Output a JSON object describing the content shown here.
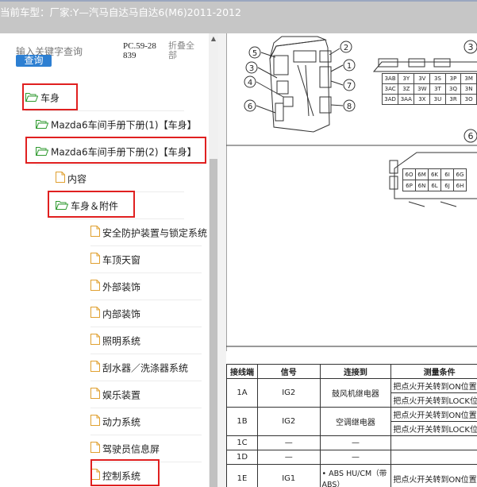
{
  "titlebar": {
    "label": "当前车型：",
    "value": "厂家:Y—汽马自达马自达6(M6)2011-2012"
  },
  "search": {
    "placeholder": "输入关键字查询",
    "button_label": "查询"
  },
  "pc_code": "PC.59-28839",
  "collapse_label": "折叠全部",
  "tree": [
    {
      "label": "车身",
      "icon": "folder-open-icon"
    },
    {
      "label": "Mazda6车间手册下册(1)【车身】",
      "icon": "folder-open-icon"
    },
    {
      "label": "Mazda6车间手册下册(2)【车身】",
      "icon": "folder-open-icon"
    },
    {
      "label": "内容",
      "icon": "document-icon"
    },
    {
      "label": "车身＆附件",
      "icon": "folder-open-icon"
    },
    {
      "label": "安全防护装置与锁定系统",
      "icon": "document-icon"
    },
    {
      "label": "车顶天窗",
      "icon": "document-icon"
    },
    {
      "label": "外部装饰",
      "icon": "document-icon"
    },
    {
      "label": "内部装饰",
      "icon": "document-icon"
    },
    {
      "label": "照明系统",
      "icon": "document-icon"
    },
    {
      "label": "刮水器／洗涤器系统",
      "icon": "document-icon"
    },
    {
      "label": "娱乐装置",
      "icon": "document-icon"
    },
    {
      "label": "动力系统",
      "icon": "document-icon"
    },
    {
      "label": "驾驶员信息屏",
      "icon": "document-icon"
    },
    {
      "label": "控制系统",
      "icon": "document-icon"
    }
  ],
  "diagram": {
    "callouts": [
      "5",
      "3",
      "4",
      "6",
      "2",
      "1",
      "7",
      "8"
    ],
    "connector3": {
      "label": "3",
      "rows": [
        [
          "3AB",
          "3Y",
          "3V",
          "3S",
          "3P",
          "3M"
        ],
        [
          "3AC",
          "3Z",
          "3W",
          "3T",
          "3Q",
          "3N"
        ],
        [
          "3AD",
          "3AA",
          "3X",
          "3U",
          "3R",
          "3O"
        ]
      ]
    },
    "connector6": {
      "label": "6",
      "rows": [
        [
          "6O",
          "6M",
          "6K",
          "6I",
          "6G"
        ],
        [
          "6P",
          "6N",
          "6L",
          "6J",
          "6H"
        ]
      ]
    }
  },
  "wiring_table": {
    "headers": [
      "接线端",
      "信号",
      "连接到",
      "测量条件"
    ],
    "rows": [
      {
        "terminal": "1A",
        "signal": "IG2",
        "connect": "鼓风机继电器",
        "cond": [
          "把点火开关转到ON位置",
          "把点火开关转到LOCK位置"
        ]
      },
      {
        "terminal": "1B",
        "signal": "IG2",
        "connect": "空调继电器",
        "cond": [
          "把点火开关转到ON位置",
          "把点火开关转到LOCK位置"
        ]
      },
      {
        "terminal": "1C",
        "signal": "—",
        "connect": "—",
        "cond": [
          ""
        ]
      },
      {
        "terminal": "1D",
        "signal": "—",
        "connect": "—",
        "cond": [
          ""
        ]
      },
      {
        "terminal": "1E",
        "signal": "IG1",
        "connect": "• ABS HU/CM（带 ABS）",
        "cond": [
          "把点火开关转到ON位置"
        ]
      }
    ]
  }
}
